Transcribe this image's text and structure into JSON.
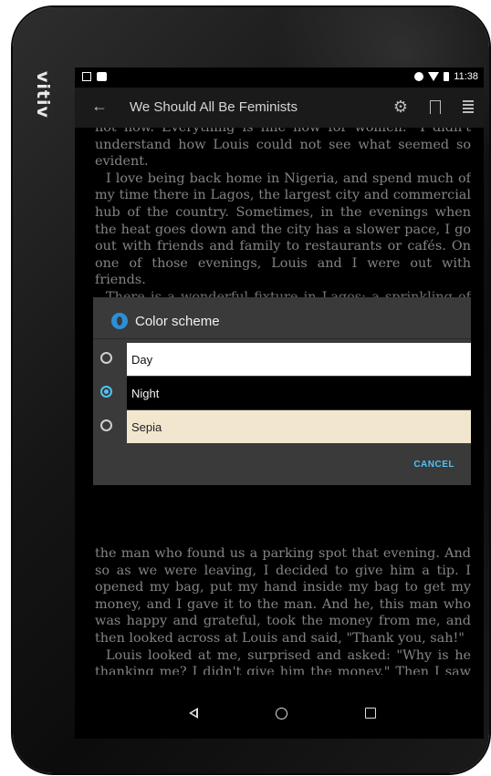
{
  "device": {
    "brand": "vitiv"
  },
  "status_bar": {
    "time": "11:38"
  },
  "app_bar": {
    "title": "We Should All Be Feminists",
    "back_icon": "arrow-left-icon",
    "settings_icon": "gear-icon",
    "bookmark_icon": "bookmark-icon",
    "toc_icon": "list-icon"
  },
  "reader": {
    "top_paragraphs": [
      "not now. Everything is fine now for women.\" I didn't understand how Louis could not see what seemed so evident.",
      "I love being back home in Nigeria, and spend much of my time there in Lagos, the largest city and commercial hub of the country. Sometimes, in the evenings when the heat goes down and the city has a slower pace, I go out with friends and family to restaurants or cafés. On one of those evenings, Louis and I were out with friends.",
      "There is a wonderful fixture in Lagos: a sprinkling of energetic young men who hang around outside certain"
    ],
    "bottom_paragraphs": [
      "the man who found us a parking spot that evening. And so as we were leaving, I decided to give him a tip. I opened my bag, put my hand inside my bag to get my money, and I gave it to the man. And he, this man who was happy and grateful, took the money from me, and then looked across at Louis and said, \"Thank you, sah!\"",
      "Louis looked at me, surprised and asked: \"Why is he thanking me? I didn't give him the money.\" Then I saw realization dawn on Louis's face. The man believed that whatever money I had ultimately came from Louis. Because Louis is a man."
    ]
  },
  "dialog": {
    "title": "Color scheme",
    "options": [
      {
        "label": "Day",
        "selected": false,
        "color": "#ffffff"
      },
      {
        "label": "Night",
        "selected": true,
        "color": "#000000"
      },
      {
        "label": "Sepia",
        "selected": false,
        "color": "#f2e6cf"
      }
    ],
    "cancel_label": "CANCEL",
    "accent_color": "#4fc3f7"
  },
  "nav_bar": {
    "back_icon": "triangle-back-icon",
    "home_icon": "circle-home-icon",
    "recents_icon": "square-recents-icon"
  }
}
